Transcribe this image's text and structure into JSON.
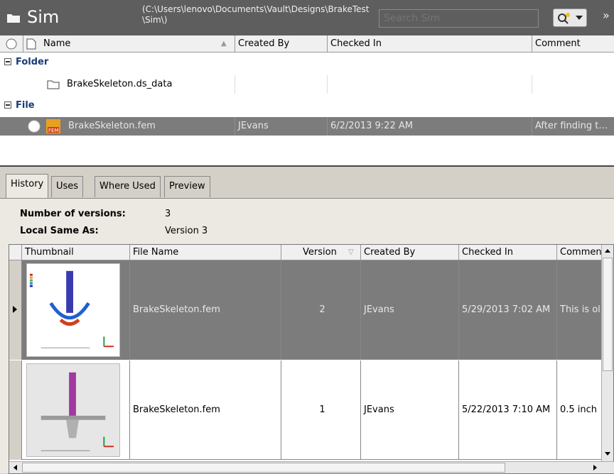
{
  "window": {
    "title": "Sim",
    "path": "(C:\\Users\\lenovo\\Documents\\Vault\\Designs\\BrakeTest\\Sim\\)",
    "search_placeholder": "Search Sim"
  },
  "file_grid": {
    "columns": [
      "Name",
      "Created By",
      "Checked In",
      "Comment"
    ],
    "groups": [
      {
        "label": "Folder",
        "rows": [
          {
            "name": "BrakeSkeleton.ds_data",
            "created_by": "",
            "checked_in": "",
            "comment": ""
          }
        ]
      },
      {
        "label": "File",
        "rows": [
          {
            "name": "BrakeSkeleton.fem",
            "created_by": "JEvans",
            "checked_in": "6/2/2013 9:22 AM",
            "comment": "After finding t…",
            "selected": true
          }
        ]
      }
    ]
  },
  "tabs": [
    "History",
    "Uses",
    "Where Used",
    "Preview"
  ],
  "history": {
    "versions_label": "Number of versions:",
    "versions_value": "3",
    "local_label": "Local Same As:",
    "local_value": "Version 3",
    "columns": [
      "Thumbnail",
      "File Name",
      "Version",
      "Created By",
      "Checked In",
      "Commen"
    ],
    "rows": [
      {
        "file_name": "BrakeSkeleton.fem",
        "version": "2",
        "created_by": "JEvans",
        "checked_in": "5/29/2013 7:02 AM",
        "comment": "This is ol",
        "selected": true
      },
      {
        "file_name": "BrakeSkeleton.fem",
        "version": "1",
        "created_by": "JEvans",
        "checked_in": "5/22/2013 7:10 AM",
        "comment": "0.5 inch",
        "selected": false
      }
    ]
  },
  "colors": {
    "title_bg": "#5e5e5e",
    "selected_row": "#7c7c7c",
    "group_label": "#1a3a7a"
  }
}
